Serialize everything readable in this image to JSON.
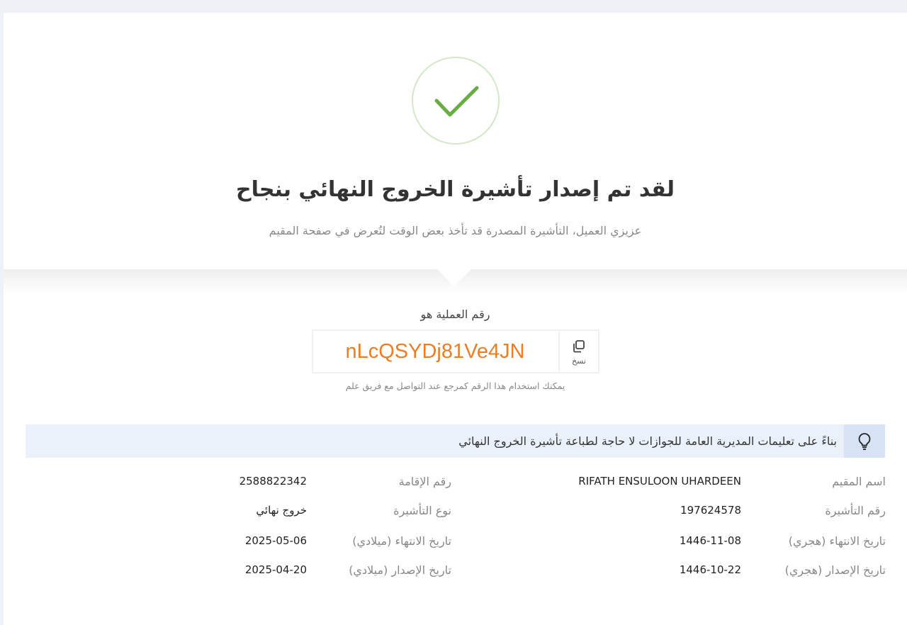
{
  "header": {
    "title": "لقد تم إصدار تأشيرة الخروج النهائي بنجاح",
    "subtitle": "عزيزي العميل، التأشيرة المصدرة قد تأخذ بعض الوقت لتُعرض في صفحة المقيم",
    "success_icon": "checkmark-icon"
  },
  "transaction": {
    "label": "رقم العملية هو",
    "code": "nLcQSYDj81Ve4JN",
    "copy_label": "نسخ",
    "copy_icon": "copy-icon",
    "hint": "يمكنك استخدام هذا الرقم كمرجع عند التواصل مع فريق علم"
  },
  "notice": {
    "icon": "lightbulb-icon",
    "text": "بناءً على تعليمات المديرية العامة للجوازات لا حاجة لطباعة تأشيرة الخروج النهائي"
  },
  "details": {
    "rows": [
      {
        "right_label": "اسم المقيم",
        "right_value": "RIFATH ENSULOON UHARDEEN",
        "left_label": "رقم الإقامة",
        "left_value": "2588822342"
      },
      {
        "right_label": "رقم التأشيرة",
        "right_value": "197624578",
        "left_label": "نوع التأشيرة",
        "left_value": "خروج نهائي"
      },
      {
        "right_label": "تاريخ الانتهاء (هجري)",
        "right_value": "1446-11-08",
        "left_label": "تاريخ الانتهاء (ميلادي)",
        "left_value": "2025-05-06"
      },
      {
        "right_label": "تاريخ الإصدار (هجري)",
        "right_value": "1446-10-22",
        "left_label": "تاريخ الإصدار (ميلادي)",
        "left_value": "2025-04-20"
      }
    ]
  },
  "colors": {
    "success": "#6aac44",
    "code": "#ee7d22",
    "notice_bg": "#eaf1fb"
  }
}
